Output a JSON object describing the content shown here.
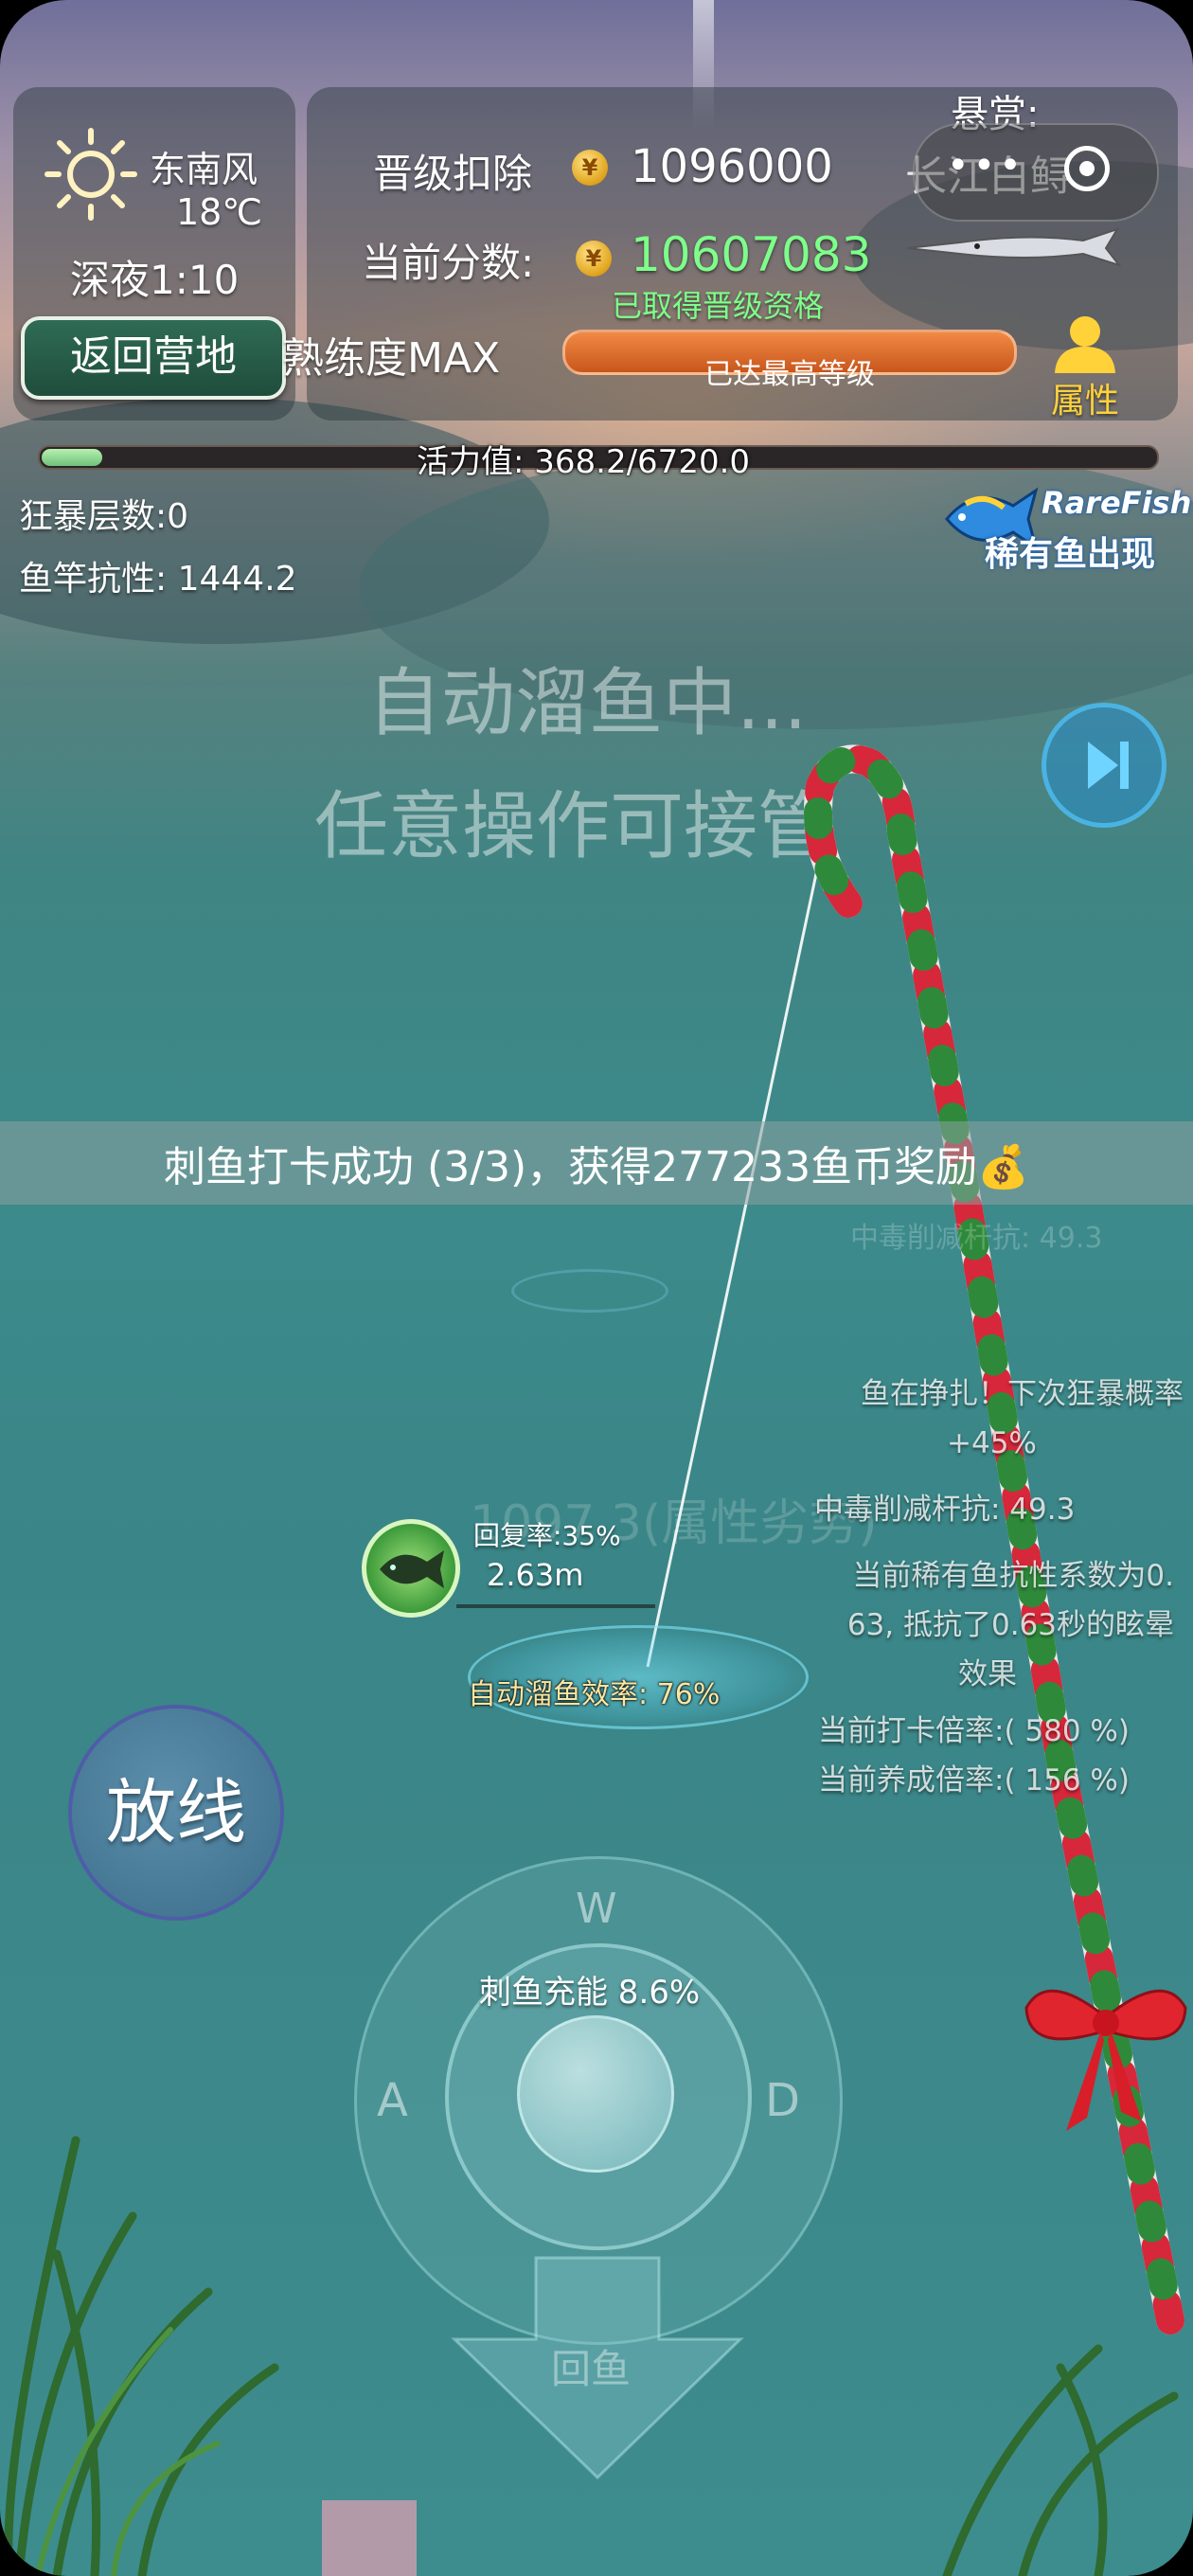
{
  "weather": {
    "icon": "sun-icon",
    "wind": "东南风",
    "temperature": "18℃",
    "time": "深夜1:10"
  },
  "camp_button": "返回营地",
  "proficiency": "熟练度MAX",
  "score": {
    "deduct_label": "晋级扣除",
    "deduct_value": "1096000",
    "current_label": "当前分数:",
    "current_value": "10607083",
    "qualified_text": "已取得晋级资格",
    "level_bar_text": "已达最高等级"
  },
  "bounty": {
    "label": "悬赏:",
    "fish_name": "长江白鲟"
  },
  "attributes_button": "属性",
  "vitality": {
    "label": "活力值: 368.2/6720.0",
    "current": 368.2,
    "max": 6720.0
  },
  "stats": {
    "rage_layers": "狂暴层数:0",
    "rod_resistance": "鱼竿抗性: 1444.2"
  },
  "rare_fish": {
    "badge_en": "RareFish",
    "badge_cn": "稀有鱼出现"
  },
  "auto_status": {
    "line1": "自动溜鱼中...",
    "line2": "任意操作可接管"
  },
  "banner": "刺鱼打卡成功 (3/3)，获得277233鱼币奖励💰",
  "faded_texts": {
    "poison_top": "中毒削减杆抗: 49.3",
    "attr_disadvantage": "1097.3(属性劣势)"
  },
  "fish_info": {
    "recovery": "回复率:35%",
    "distance": "2.63m",
    "auto_efficiency": "自动溜鱼效率: 76%"
  },
  "combat_log": [
    "鱼在挣扎！下次狂暴概率",
    "+45%",
    "中毒削减杆抗: 49.3",
    "当前稀有鱼抗性系数为0.",
    "63, 抵抗了0.63秒的眩晕",
    "效果",
    "当前打卡倍率:( 580 %)",
    "当前养成倍率:( 156 %)"
  ],
  "release_button": "放线",
  "joystick": {
    "charge": "刺鱼充能 8.6%",
    "key_w": "W",
    "key_a": "A",
    "key_d": "D",
    "reel_label": "回鱼"
  },
  "colors": {
    "score_green": "#7dff8a",
    "level_bar": "#e8753a",
    "vitality_fill": "#8fd990",
    "water": "#3c8a8b"
  }
}
